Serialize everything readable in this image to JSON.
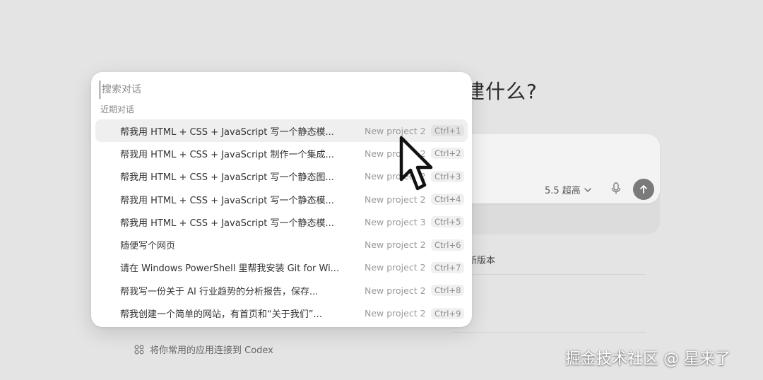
{
  "background": {
    "heading": "建什么?",
    "model_select": {
      "label": "5.5 超高"
    },
    "version_text": "新版本",
    "connect_apps": "将你常用的应用连接到 Codex"
  },
  "palette": {
    "search_placeholder": "搜索对话",
    "section_label": "近期对话",
    "conversations": [
      {
        "title": "帮我用 HTML + CSS + JavaScript 写一个静态模...",
        "project": "New project 2",
        "shortcut": "Ctrl+1"
      },
      {
        "title": "帮我用 HTML + CSS + JavaScript 制作一个集成...",
        "project": "New project 2",
        "shortcut": "Ctrl+2"
      },
      {
        "title": "帮我用 HTML + CSS + JavaScript 写一个静态图...",
        "project": "New project 2",
        "shortcut": "Ctrl+3"
      },
      {
        "title": "帮我用 HTML + CSS + JavaScript 写一个静态模...",
        "project": "New project 2",
        "shortcut": "Ctrl+4"
      },
      {
        "title": "帮我用 HTML + CSS + JavaScript 写一个静态模...",
        "project": "New project 3",
        "shortcut": "Ctrl+5"
      },
      {
        "title": "随便写个网页",
        "project": "New project 2",
        "shortcut": "Ctrl+6"
      },
      {
        "title": "请在 Windows PowerShell 里帮我安装 Git for Wi...",
        "project": "New project 2",
        "shortcut": "Ctrl+7"
      },
      {
        "title": "帮我写一份关于 AI 行业趋势的分析报告，保存...",
        "project": "New project 2",
        "shortcut": "Ctrl+8"
      },
      {
        "title": "帮我创建一个简单的网站，有首页和“关于我们”...",
        "project": "New project 2",
        "shortcut": "Ctrl+9"
      }
    ]
  },
  "watermark": "掘金技术社区 @ 星来了",
  "icons": {
    "cursor": "arrow-cursor-icon",
    "mic": "microphone-icon",
    "send": "arrow-up-icon",
    "apps": "apps-grid-icon",
    "chevron": "chevron-down-icon"
  },
  "colors": {
    "backdrop": "#e4e4e4",
    "palette_bg": "#ffffff",
    "active_row": "#efefef",
    "send_button": "#7a7a7a"
  }
}
